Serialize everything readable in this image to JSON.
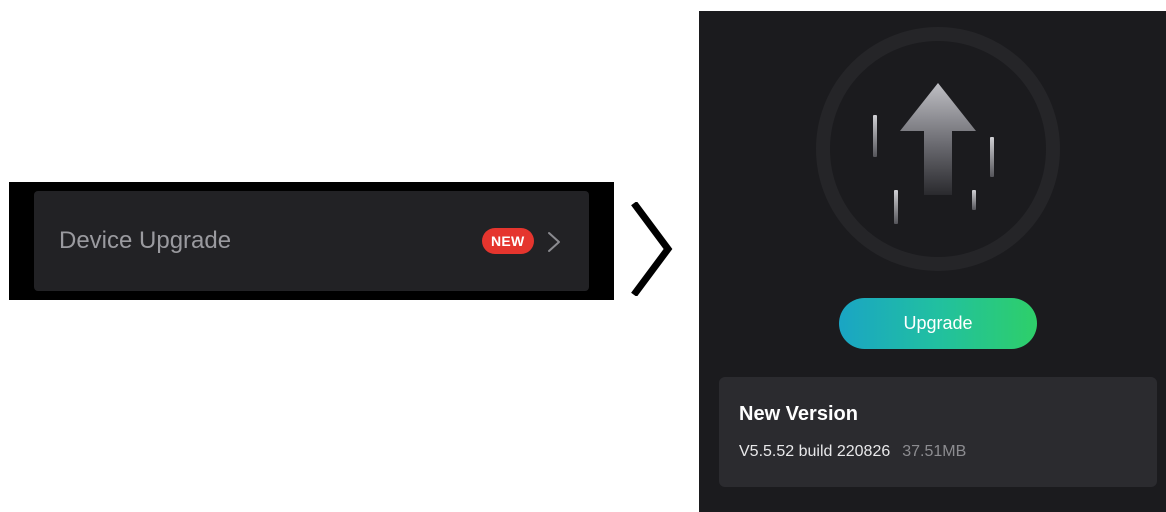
{
  "left_panel": {
    "row_label": "Device Upgrade",
    "badge": "NEW",
    "icons": {
      "row_chevron": "chevron-right-icon"
    }
  },
  "transition": {
    "icon": "chevron-right-icon"
  },
  "right_panel": {
    "hero_icon": "upgrade-arrow-icon",
    "button_label": "Upgrade",
    "version_card": {
      "title": "New Version",
      "version": "V5.5.52 build 220826",
      "size": "37.51MB"
    }
  },
  "colors": {
    "badge_red": "#e5352e",
    "button_gradient_start": "#1aa5c4",
    "button_gradient_end": "#2ecf69",
    "panel_dark": "#1b1b1e",
    "card_dark": "#2b2b2f"
  }
}
